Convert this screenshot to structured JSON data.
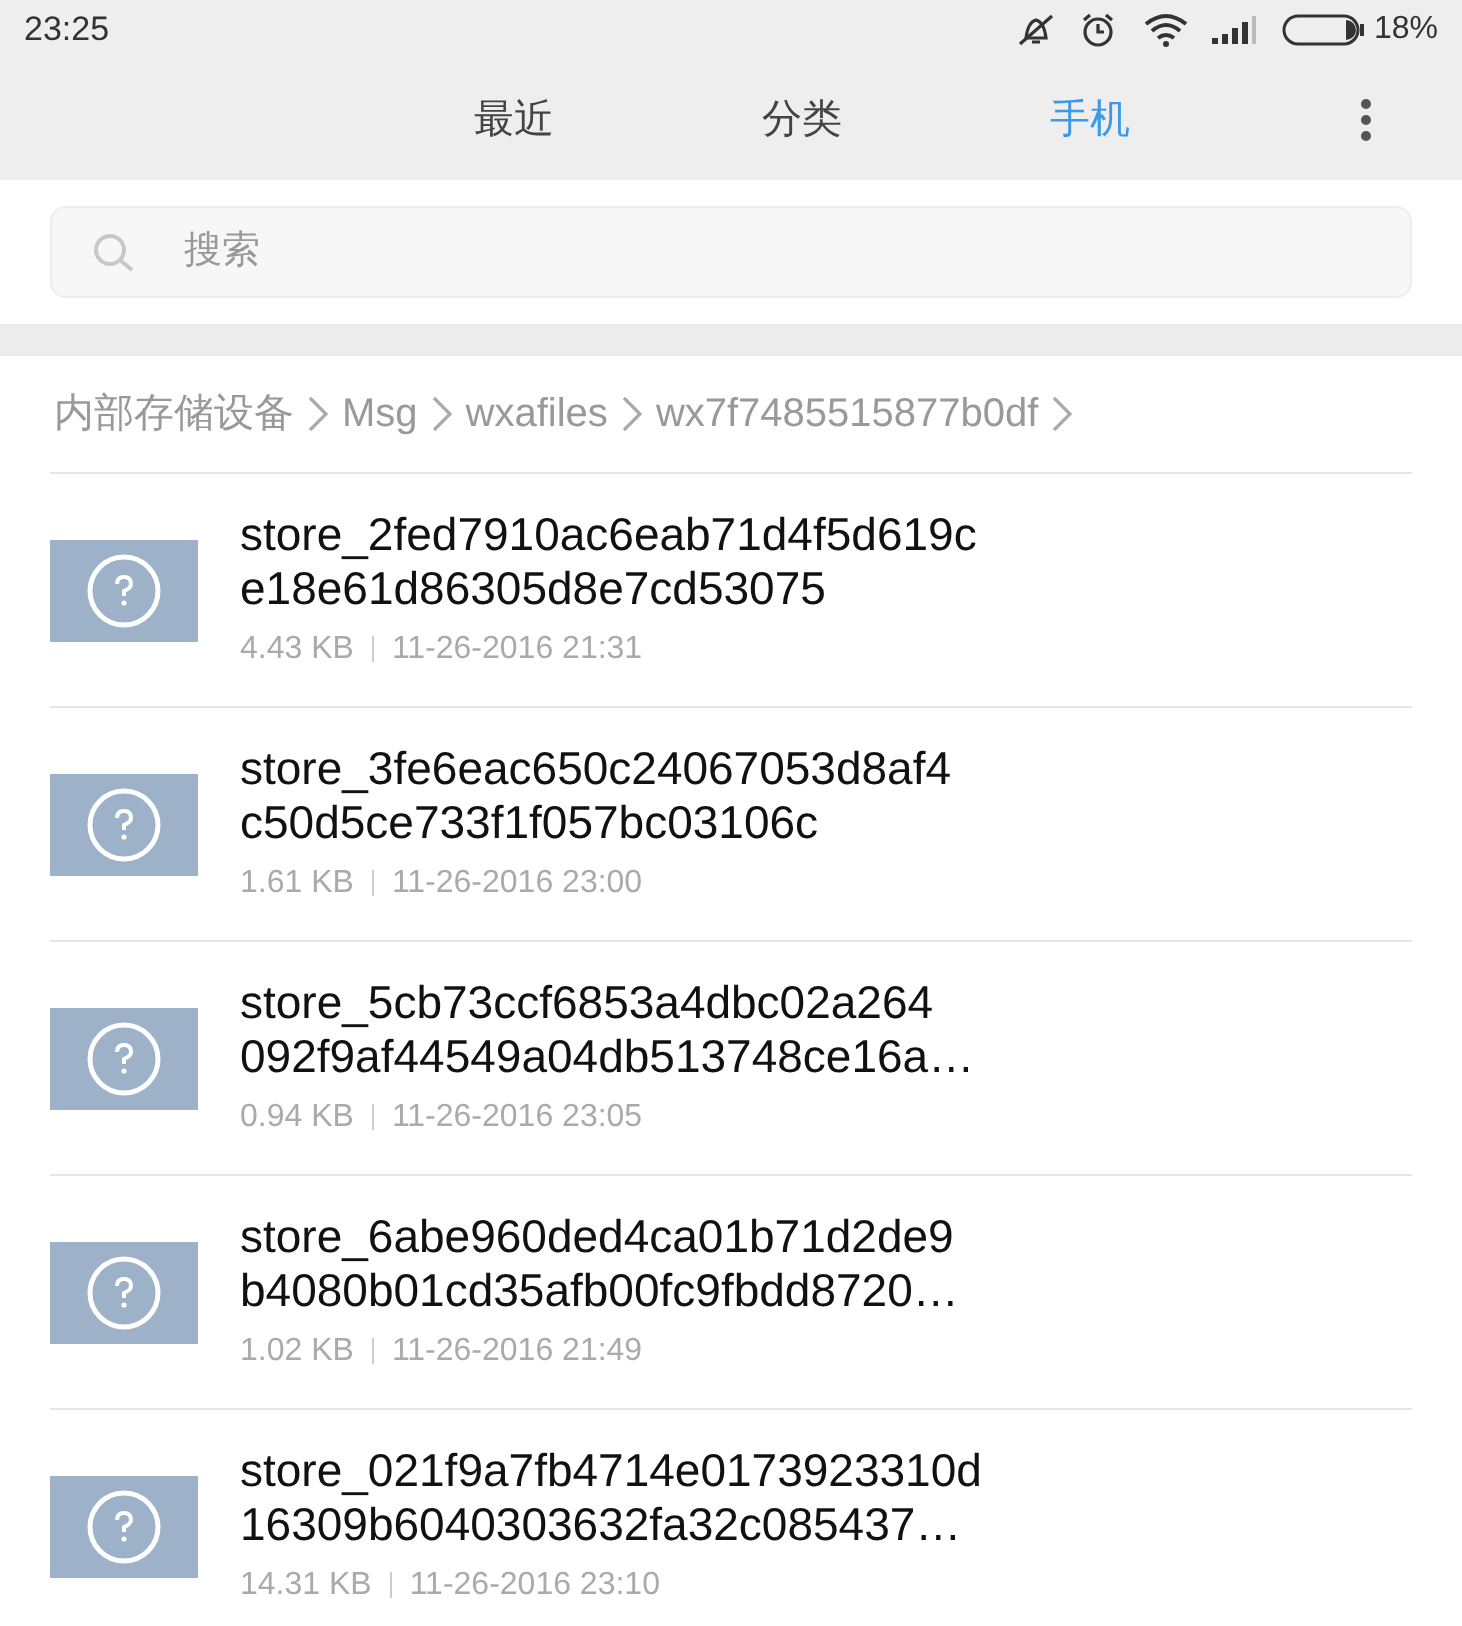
{
  "status_bar": {
    "time": "23:25",
    "battery": "18%"
  },
  "tabs": [
    {
      "label": "最近",
      "selected": false
    },
    {
      "label": "分类",
      "selected": false
    },
    {
      "label": "手机",
      "selected": true
    }
  ],
  "search": {
    "placeholder": "搜索"
  },
  "breadcrumb": [
    "内部存储设备",
    "Msg",
    "wxafiles",
    "wx7f7485515877b0df"
  ],
  "files": [
    {
      "name_lines": [
        "store_2fed7910ac6eab71d4f5d619c",
        "e18e61d86305d8e7cd53075"
      ],
      "size": "4.43 KB",
      "date": "11-26-2016 21:31"
    },
    {
      "name_lines": [
        "store_3fe6eac650c24067053d8af4",
        "c50d5ce733f1f057bc03106c"
      ],
      "size": "1.61 KB",
      "date": "11-26-2016 23:00"
    },
    {
      "name_lines": [
        "store_5cb73ccf6853a4dbc02a264",
        "092f9af44549a04db513748ce16a…"
      ],
      "size": "0.94 KB",
      "date": "11-26-2016 23:05"
    },
    {
      "name_lines": [
        "store_6abe960ded4ca01b71d2de9",
        "b4080b01cd35afb00fc9fbdd8720…"
      ],
      "size": "1.02 KB",
      "date": "11-26-2016 21:49"
    },
    {
      "name_lines": [
        "store_021f9a7fb4714e0173923310d",
        "16309b6040303632fa32c085437…"
      ],
      "size": "14.31 KB",
      "date": "11-26-2016 23:10"
    }
  ]
}
